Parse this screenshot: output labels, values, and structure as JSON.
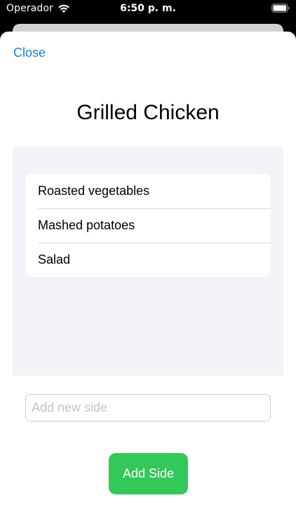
{
  "status_bar": {
    "carrier": "Operador",
    "time": "6:50 p. m."
  },
  "sheet": {
    "close_label": "Close",
    "title": "Grilled Chicken",
    "sides": [
      {
        "label": "Roasted vegetables"
      },
      {
        "label": "Mashed potatoes"
      },
      {
        "label": "Salad"
      }
    ],
    "new_side": {
      "value": "",
      "placeholder": "Add new side"
    },
    "add_button_label": "Add Side"
  },
  "colors": {
    "accent": "#1a82c9",
    "add_button": "#34c759",
    "list_background": "#f2f2f7"
  },
  "icons": {
    "wifi": "wifi-icon",
    "battery": "battery-icon"
  }
}
